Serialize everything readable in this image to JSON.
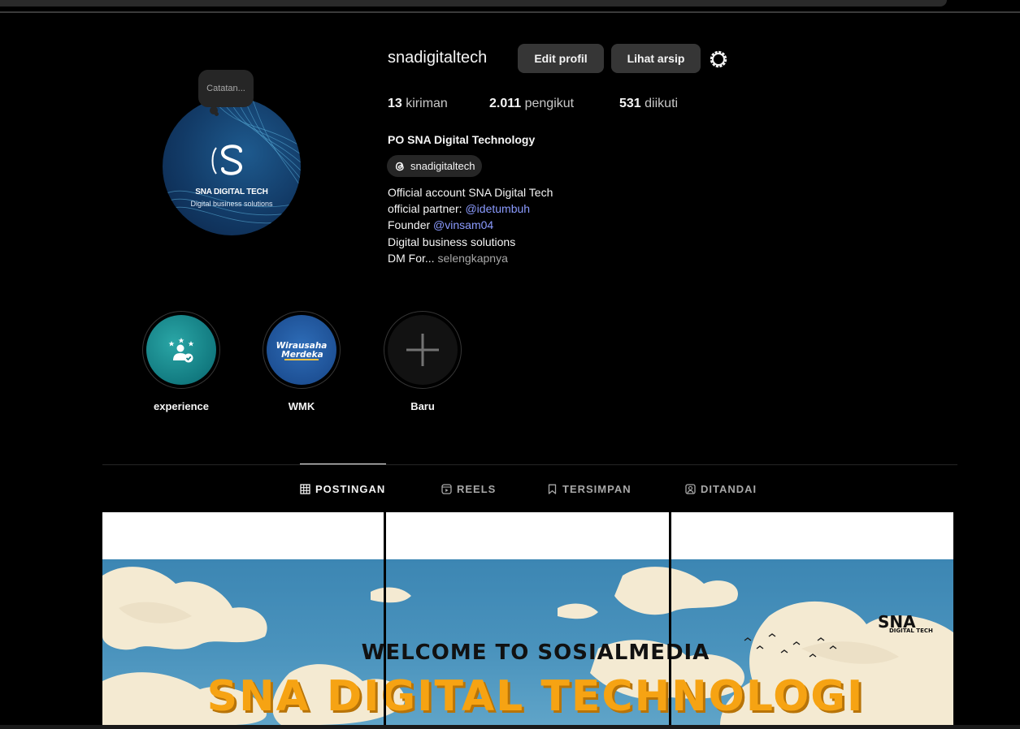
{
  "profile": {
    "username": "snadigitaltech",
    "edit_label": "Edit profil",
    "archive_label": "Lihat arsip",
    "note_placeholder": "Catatan...",
    "avatar_title": "SNA DIGITAL TECH",
    "avatar_subtitle": "Digital business solutions",
    "stats": {
      "posts_count": "13",
      "posts_label": "kiriman",
      "followers_count": "2.011",
      "followers_label": "pengikut",
      "following_count": "531",
      "following_label": "diikuti"
    },
    "full_name": "PO SNA Digital Technology",
    "threads_handle": "snadigitaltech",
    "bio": {
      "line1": "Official account SNA Digital Tech",
      "line2_prefix": "official partner: ",
      "line2_link": "@idetumbuh",
      "line3_prefix": "Founder ",
      "line3_link": "@vinsam04",
      "line4": "Digital business solutions",
      "line5_prefix": "DM For...",
      "more_label": " selengkapnya"
    }
  },
  "highlights": [
    {
      "label": "experience",
      "icon": "user-stars-check-icon"
    },
    {
      "label": "WMK",
      "icon": "wirausaha-merdeka-logo",
      "logo_text_1": "Wirausaha",
      "logo_text_2": "Merdeka"
    },
    {
      "label": "Baru",
      "icon": "plus-icon"
    }
  ],
  "tabs": [
    {
      "label": "POSTINGAN",
      "icon": "grid-icon",
      "active": true
    },
    {
      "label": "REELS",
      "icon": "reels-icon",
      "active": false
    },
    {
      "label": "TERSIMPAN",
      "icon": "bookmark-icon",
      "active": false
    },
    {
      "label": "DITANDAI",
      "icon": "tagged-icon",
      "active": false
    }
  ],
  "post_banner": {
    "welcome_text": "WELCOME TO SOSIALMEDIA",
    "title_text": "SNA DIGITAL TECHNOLOGI",
    "logo_text": "SNA",
    "logo_sub": "DIGITAL TECH"
  },
  "colors": {
    "background": "#000000",
    "button": "#363636",
    "link": "#8b9bff",
    "banner_title": "#f6a313",
    "sky": "#4a93bd"
  }
}
